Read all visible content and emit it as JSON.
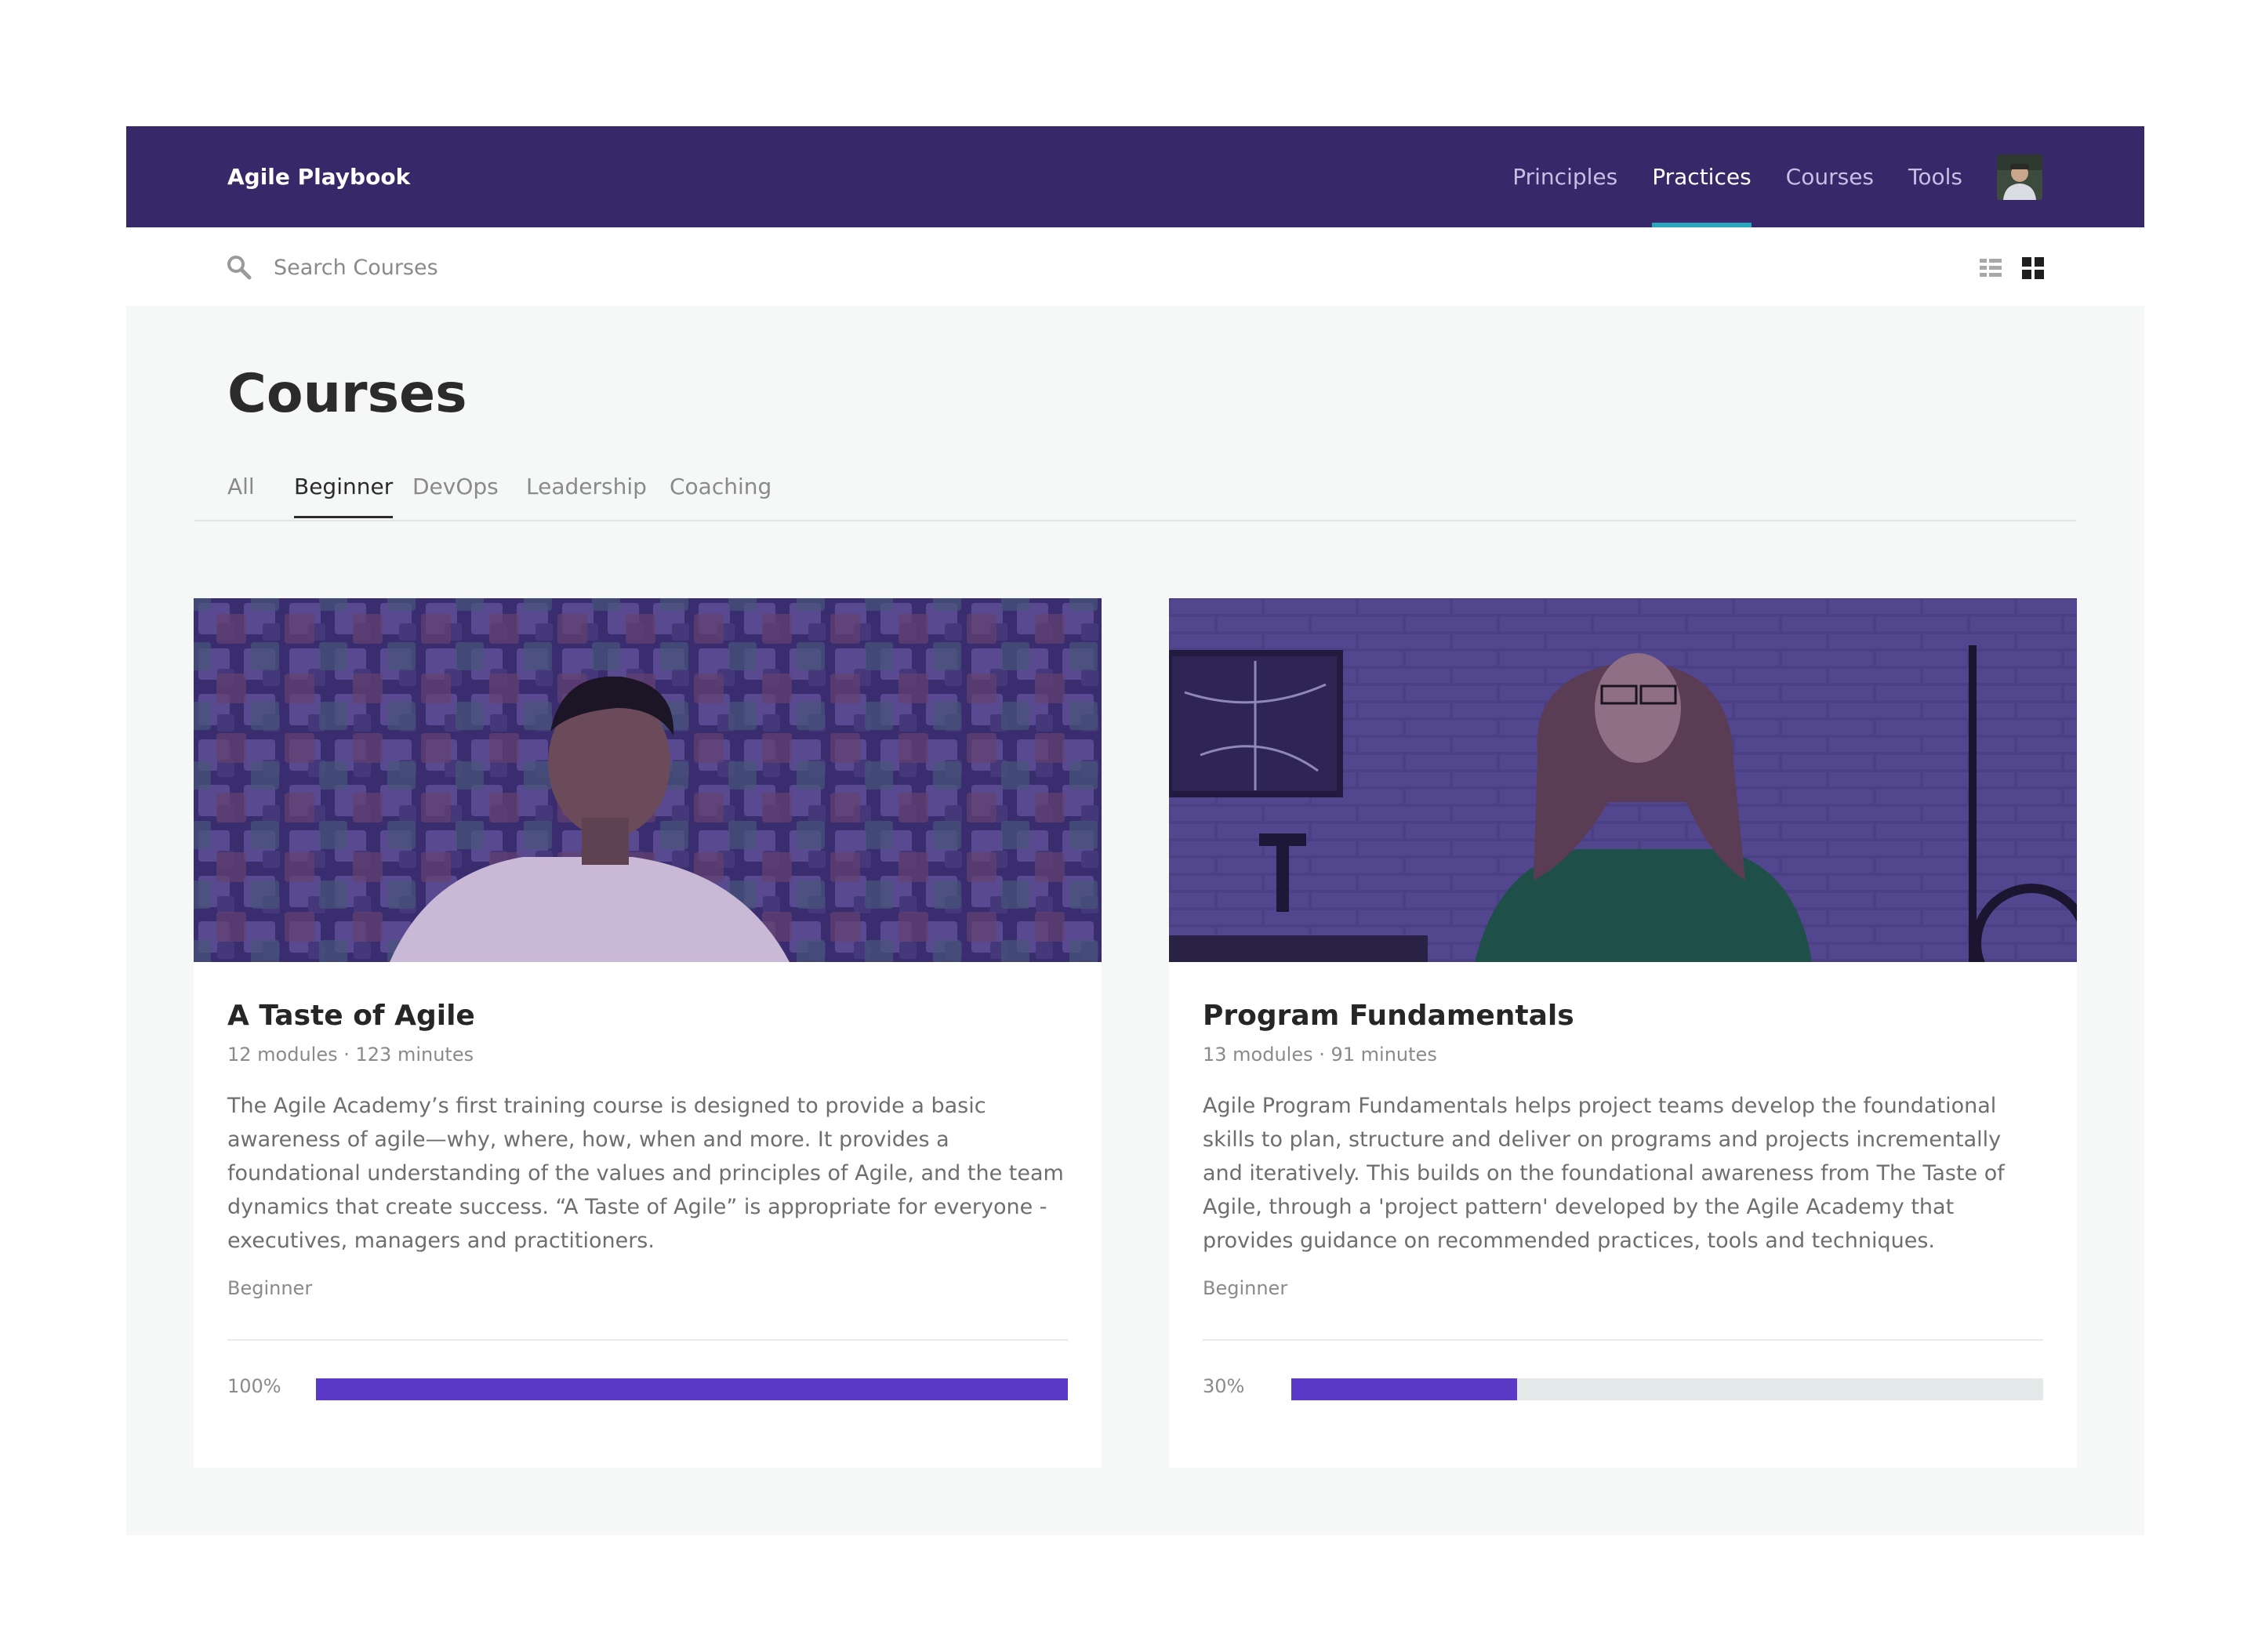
{
  "header": {
    "brand": "Agile Playbook",
    "nav": [
      {
        "label": "Principles",
        "active": false
      },
      {
        "label": "Practices",
        "active": true
      },
      {
        "label": "Courses",
        "active": false
      },
      {
        "label": "Tools",
        "active": false
      }
    ],
    "avatar_icon": "user-avatar"
  },
  "search": {
    "placeholder": "Search Courses",
    "value": "",
    "icon": "search-icon"
  },
  "view_toggle": {
    "list_icon": "list-view-icon",
    "grid_icon": "grid-view-icon",
    "selected": "grid"
  },
  "page": {
    "title": "Courses"
  },
  "tabs": [
    {
      "label": "All",
      "active": false
    },
    {
      "label": "Beginner",
      "active": true
    },
    {
      "label": "DevOps",
      "active": false
    },
    {
      "label": "Leadership",
      "active": false
    },
    {
      "label": "Coaching",
      "active": false
    }
  ],
  "courses": [
    {
      "title": "A Taste of Agile",
      "meta": "12 modules · 123 minutes",
      "description": "The Agile Academy’s first training course is designed to provide a basic awareness of agile—why, where, how, when and more. It provides a foundational understanding of the values and principles of Agile, and the team dynamics that create success. “A Taste of Agile” is appropriate for everyone - executives, managers and practitioners.",
      "level": "Beginner",
      "progress_label": "100%",
      "progress": 1.0
    },
    {
      "title": "Program Fundamentals",
      "meta": "13 modules · 91 minutes",
      "description": "Agile Program Fundamentals helps project teams develop the foundational skills to plan, structure and deliver on programs and projects incrementally and iteratively. This builds on the foundational awareness from The Taste of Agile, through a 'project pattern' developed by the Agile Academy that provides guidance on recommended practices, tools and techniques.",
      "level": "Beginner",
      "progress_label": "30%",
      "progress": 0.3
    }
  ],
  "colors": {
    "header_bg": "#372869",
    "accent_underline": "#2aa5bb",
    "progress_fill": "#5939c6",
    "progress_track": "#e4eaea"
  }
}
